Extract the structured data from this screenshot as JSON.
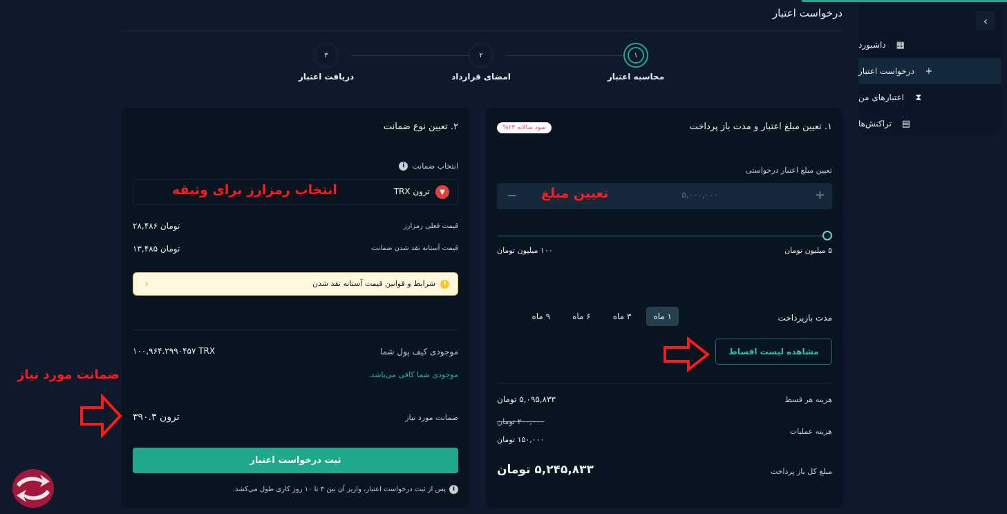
{
  "page": {
    "title": "درخواست اعتبار"
  },
  "sidebar": {
    "toggle_icon": "›",
    "items": [
      {
        "label": "داشبورد",
        "icon": "grid-icon",
        "glyph": "▦",
        "active": false
      },
      {
        "label": "درخواست اعتبار",
        "icon": "plus-icon",
        "glyph": "+",
        "active": true
      },
      {
        "label": "اعتبارهای من",
        "icon": "hourglass-icon",
        "glyph": "⧗",
        "active": false
      },
      {
        "label": "تراکنش‌ها",
        "icon": "clipboard-icon",
        "glyph": "📋",
        "active": false
      }
    ]
  },
  "stepper": {
    "steps": [
      {
        "number": "۱",
        "label": "محاسبه اعتبار",
        "active": true
      },
      {
        "number": "۲",
        "label": "امضای قرارداد",
        "active": false
      },
      {
        "number": "۳",
        "label": "دریافت اعتبار",
        "active": false
      }
    ]
  },
  "credit_card": {
    "title": "۱. تعیین مبلغ اعتبار و مدت باز پرداخت",
    "interest_badge": "سود سالانه ۲۳%",
    "amount_label": "تعیین مبلغ اعتبار درخواستی",
    "amount_value": "۵,۰۰۰,۰۰۰",
    "amount_annotation": "تعیین مبلغ",
    "slider": {
      "min_label": "۵ میلیون تومان",
      "max_label": "۱۰۰ میلیون تومان",
      "min": 5,
      "max": 100,
      "value": 5,
      "unit": "million toman"
    },
    "term_label": "مدت بازپرداخت",
    "terms": [
      {
        "label": "۱ ماه",
        "active": true
      },
      {
        "label": "۳ ماه",
        "active": false
      },
      {
        "label": "۶ ماه",
        "active": false
      },
      {
        "label": "۹ ماه",
        "active": false
      }
    ],
    "installments_button": "مشاهده لیست اقساط",
    "installment_cost_label": "هزینه هر قسط",
    "installment_cost_value": "۵,۰۹۵,۸۳۳ تومان",
    "operation_fee_label": "هزینه عملیات",
    "operation_fee_old": "۲۰۰,۰۰۰ تومان",
    "operation_fee_new": "۱۵۰,۰۰۰ تومان",
    "total_label": "مبلغ کل باز پرداخت",
    "total_value": "۵,۲۴۵,۸۳۳ تومان"
  },
  "collateral_card": {
    "title": "۲. تعیین نوع ضمانت",
    "select_label": "انتخاب ضمانت",
    "selected_coin": "ترون TRX",
    "select_annotation": "انتخاب رمزارز برای وثیقه",
    "current_price_label": "قیمت فعلی رمزارز",
    "current_price_value": "تومان ۲۸,۴۸۶",
    "liquidation_label": "قیمت آستانه نقد شدن ضمانت",
    "liquidation_value": "تومان ۱۳,۴۸۵",
    "warning_text": "شرایط و قوانین قیمت آستانه نقد شدن",
    "wallet_label": "موجودی کیف پول شما",
    "wallet_value": "۱۰۰,۹۶۴.۲۹۹۰۴۵۷ TRX",
    "sufficient_text": "موجودی شما کافی می‌باشد.",
    "required_label": "ضمانت مورد نیاز",
    "required_value": "ترون ۳۹۰.۳",
    "required_annotation": "ضمانت مورد نیاز",
    "submit_button": "ثبت درخواست اعتبار",
    "note": "پس از ثبت درخواست اعتبار، واریز آن بین ۳ تا ۱۰ روز کاری طول می‌کشد."
  },
  "colors": {
    "accent": "#1fa98a",
    "background": "#0e1a2b",
    "card": "#08141f",
    "annotation": "#ff1a1a",
    "warning_bg": "#fff8df"
  }
}
